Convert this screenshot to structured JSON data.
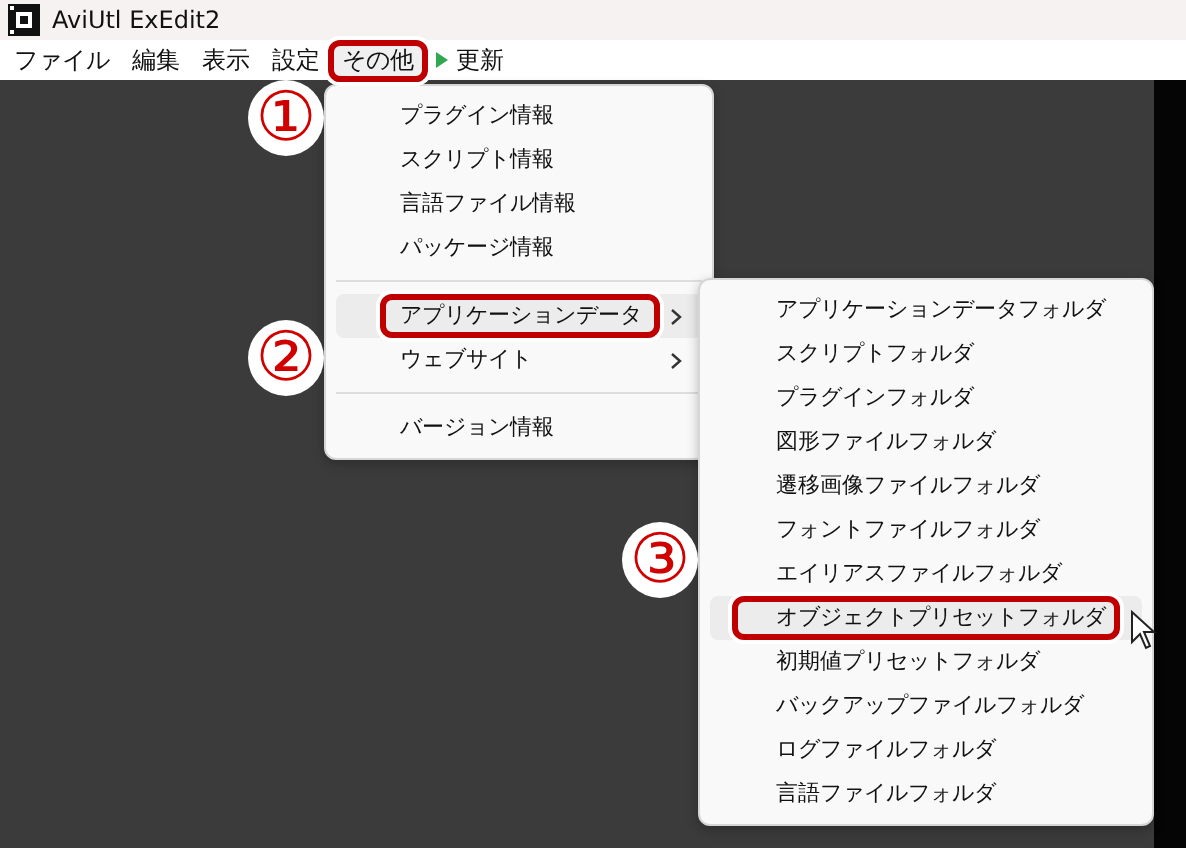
{
  "window": {
    "title": "AviUtl ExEdit2"
  },
  "menubar": [
    {
      "label": "ファイル",
      "selected": false,
      "indicator": false
    },
    {
      "label": "編集",
      "selected": false,
      "indicator": false
    },
    {
      "label": "表示",
      "selected": false,
      "indicator": false
    },
    {
      "label": "設定",
      "selected": false,
      "indicator": false
    },
    {
      "label": "その他",
      "selected": true,
      "indicator": false
    },
    {
      "label": "更新",
      "selected": false,
      "indicator": true
    }
  ],
  "menu": [
    {
      "kind": "item",
      "label": "プラグイン情報",
      "submenu": false,
      "selected": false
    },
    {
      "kind": "item",
      "label": "スクリプト情報",
      "submenu": false,
      "selected": false
    },
    {
      "kind": "item",
      "label": "言語ファイル情報",
      "submenu": false,
      "selected": false
    },
    {
      "kind": "item",
      "label": "パッケージ情報",
      "submenu": false,
      "selected": false
    },
    {
      "kind": "separator"
    },
    {
      "kind": "item",
      "label": "アプリケーションデータ",
      "submenu": true,
      "selected": true
    },
    {
      "kind": "item",
      "label": "ウェブサイト",
      "submenu": true,
      "selected": false
    },
    {
      "kind": "separator"
    },
    {
      "kind": "item",
      "label": "バージョン情報",
      "submenu": false,
      "selected": false
    }
  ],
  "submenu": [
    {
      "kind": "item",
      "label": "アプリケーションデータフォルダ",
      "selected": false
    },
    {
      "kind": "item",
      "label": "スクリプトフォルダ",
      "selected": false
    },
    {
      "kind": "item",
      "label": "プラグインフォルダ",
      "selected": false
    },
    {
      "kind": "item",
      "label": "図形ファイルフォルダ",
      "selected": false
    },
    {
      "kind": "item",
      "label": "遷移画像ファイルフォルダ",
      "selected": false
    },
    {
      "kind": "item",
      "label": "フォントファイルフォルダ",
      "selected": false
    },
    {
      "kind": "item",
      "label": "エイリアスファイルフォルダ",
      "selected": false
    },
    {
      "kind": "item",
      "label": "オブジェクトプリセットフォルダ",
      "selected": true
    },
    {
      "kind": "item",
      "label": "初期値プリセットフォルダ",
      "selected": false
    },
    {
      "kind": "item",
      "label": "バックアップファイルフォルダ",
      "selected": false
    },
    {
      "kind": "item",
      "label": "ログファイルフォルダ",
      "selected": false
    },
    {
      "kind": "item",
      "label": "言語ファイルフォルダ",
      "selected": false
    }
  ],
  "annotations": [
    {
      "number": "①"
    },
    {
      "number": "②"
    },
    {
      "number": "③"
    }
  ]
}
